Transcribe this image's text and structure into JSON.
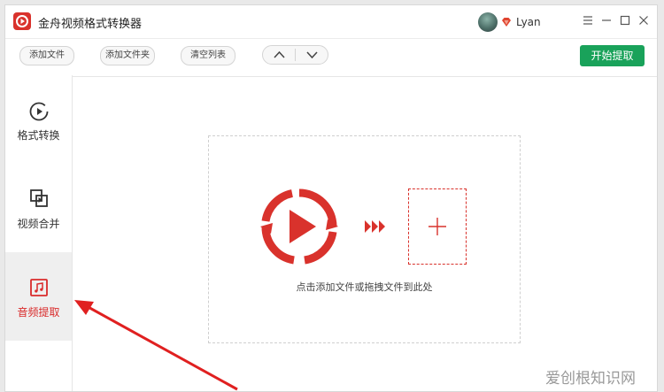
{
  "app": {
    "title": "金舟视频格式转换器"
  },
  "user": {
    "name": "Lyan"
  },
  "toolbar": {
    "add_file": "添加文件",
    "add_folder": "添加文件夹",
    "clear_list": "清空列表",
    "start": "开始提取"
  },
  "sidebar": {
    "items": [
      {
        "label": "格式转换",
        "icon": "play-circle-icon",
        "active": false
      },
      {
        "label": "视频合并",
        "icon": "merge-squares-icon",
        "active": false
      },
      {
        "label": "音频提取",
        "icon": "music-note-icon",
        "active": true
      }
    ]
  },
  "main": {
    "hint": "点击添加文件或拖拽文件到此处"
  },
  "watermark": "爱创根知识网",
  "colors": {
    "accent_red": "#d9322c",
    "start_green": "#19a25a",
    "active_bg": "#efefef"
  }
}
